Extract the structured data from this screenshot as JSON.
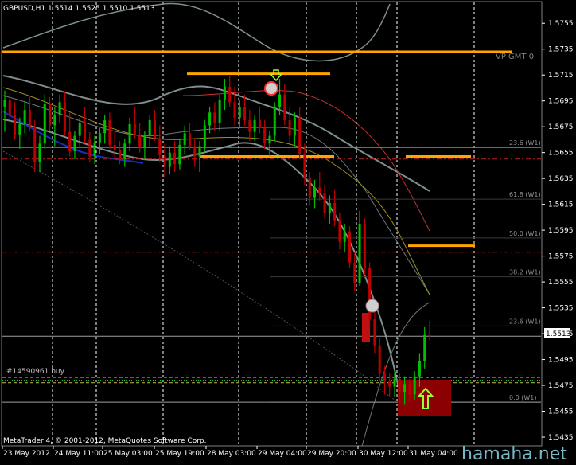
{
  "header": {
    "symbol_line": "GBPUSD,H1  1.5514 1.5525 1.5510 1.5513",
    "copyright": "MetaTrader 4, © 2001-2012, MetaQuotes Software Corp.",
    "watermark": "hamaha.net",
    "vp_label": "VP GMT 0",
    "order_label": "#14590961 buy"
  },
  "colors": {
    "background": "#000000",
    "bull_bar": "#00c000",
    "bear_bar": "#c00000",
    "grid": "#ffffff",
    "resistance": "#ffa500",
    "axis_text": "#ffffff",
    "price_tag_bg": "#ffffff",
    "envelope": "#7f8f8f",
    "zone_fill": "#8b0000",
    "arrow": "#9aff30"
  },
  "chart_data": {
    "type": "candlestick",
    "title": "GBPUSD,H1",
    "ylim": [
      1.5435,
      1.5765
    ],
    "y_ticks": [
      "1.5755",
      "1.5735",
      "1.5715",
      "1.5695",
      "1.5675",
      "1.5655",
      "1.5635",
      "1.5615",
      "1.5595",
      "1.5575",
      "1.5555",
      "1.5535",
      "1.5515",
      "1.5495",
      "1.5475",
      "1.5455",
      "1.5435"
    ],
    "current_price": "1.5513",
    "x_labels": [
      "23 May 2012",
      "24 May 11:00",
      "25 May 03:00",
      "25 May 19:00",
      "28 May 03:00",
      "29 May 04:00",
      "29 May 20:00",
      "30 May 12:00",
      "31 May 04:00"
    ],
    "fib_levels": [
      {
        "label": "23.6 (W1)",
        "value": 1.5659
      },
      {
        "label": "61.8 (W1)",
        "value": 1.5619
      },
      {
        "label": "50.0 (W1)",
        "value": 1.5589
      },
      {
        "label": "38.2 (W1)",
        "value": 1.5559
      },
      {
        "label": "23.6 (W1)",
        "value": 1.5521
      },
      {
        "label": "0.0 (W1)",
        "value": 1.5462
      }
    ],
    "resistance_levels": [
      1.5733,
      1.5716,
      1.5652,
      1.5583
    ],
    "dashed_levels": [
      1.565,
      1.5578,
      1.5481,
      1.5477
    ],
    "order_level": 1.5479,
    "ohlc": [
      {
        "o": 1.569,
        "h": 1.5703,
        "l": 1.5671,
        "c": 1.5696
      },
      {
        "o": 1.5696,
        "h": 1.5701,
        "l": 1.568,
        "c": 1.5684
      },
      {
        "o": 1.5684,
        "h": 1.5694,
        "l": 1.5665,
        "c": 1.5669
      },
      {
        "o": 1.5669,
        "h": 1.5682,
        "l": 1.5658,
        "c": 1.5677
      },
      {
        "o": 1.5677,
        "h": 1.5695,
        "l": 1.567,
        "c": 1.5688
      },
      {
        "o": 1.5688,
        "h": 1.5698,
        "l": 1.5672,
        "c": 1.5675
      },
      {
        "o": 1.5675,
        "h": 1.568,
        "l": 1.564,
        "c": 1.5648
      },
      {
        "o": 1.5648,
        "h": 1.5668,
        "l": 1.564,
        "c": 1.5662
      },
      {
        "o": 1.5662,
        "h": 1.57,
        "l": 1.5658,
        "c": 1.5693
      },
      {
        "o": 1.5693,
        "h": 1.5698,
        "l": 1.5672,
        "c": 1.5676
      },
      {
        "o": 1.5676,
        "h": 1.569,
        "l": 1.566,
        "c": 1.5684
      },
      {
        "o": 1.5684,
        "h": 1.57,
        "l": 1.5678,
        "c": 1.5694
      },
      {
        "o": 1.5694,
        "h": 1.5702,
        "l": 1.5668,
        "c": 1.5671
      },
      {
        "o": 1.5671,
        "h": 1.5686,
        "l": 1.5652,
        "c": 1.5656
      },
      {
        "o": 1.5656,
        "h": 1.5672,
        "l": 1.565,
        "c": 1.5668
      },
      {
        "o": 1.5668,
        "h": 1.5682,
        "l": 1.566,
        "c": 1.5678
      },
      {
        "o": 1.5678,
        "h": 1.569,
        "l": 1.5662,
        "c": 1.5665
      },
      {
        "o": 1.5665,
        "h": 1.5671,
        "l": 1.5648,
        "c": 1.5652
      },
      {
        "o": 1.5652,
        "h": 1.5668,
        "l": 1.5646,
        "c": 1.5663
      },
      {
        "o": 1.5663,
        "h": 1.5674,
        "l": 1.5654,
        "c": 1.567
      },
      {
        "o": 1.567,
        "h": 1.5684,
        "l": 1.5662,
        "c": 1.568
      },
      {
        "o": 1.568,
        "h": 1.5686,
        "l": 1.5658,
        "c": 1.5661
      },
      {
        "o": 1.5661,
        "h": 1.5672,
        "l": 1.565,
        "c": 1.5657
      },
      {
        "o": 1.5657,
        "h": 1.5664,
        "l": 1.5646,
        "c": 1.565
      },
      {
        "o": 1.565,
        "h": 1.5666,
        "l": 1.5644,
        "c": 1.5662
      },
      {
        "o": 1.5662,
        "h": 1.5682,
        "l": 1.5656,
        "c": 1.5677
      },
      {
        "o": 1.5677,
        "h": 1.569,
        "l": 1.5666,
        "c": 1.5669
      },
      {
        "o": 1.5669,
        "h": 1.5678,
        "l": 1.5655,
        "c": 1.5659
      },
      {
        "o": 1.5659,
        "h": 1.5672,
        "l": 1.565,
        "c": 1.5668
      },
      {
        "o": 1.5668,
        "h": 1.5684,
        "l": 1.566,
        "c": 1.568
      },
      {
        "o": 1.568,
        "h": 1.5688,
        "l": 1.5664,
        "c": 1.5666
      },
      {
        "o": 1.5666,
        "h": 1.5676,
        "l": 1.5648,
        "c": 1.5653
      },
      {
        "o": 1.5653,
        "h": 1.5662,
        "l": 1.5636,
        "c": 1.5644
      },
      {
        "o": 1.5644,
        "h": 1.566,
        "l": 1.5638,
        "c": 1.5655
      },
      {
        "o": 1.5655,
        "h": 1.5664,
        "l": 1.564,
        "c": 1.5646
      },
      {
        "o": 1.5646,
        "h": 1.5666,
        "l": 1.5642,
        "c": 1.5661
      },
      {
        "o": 1.5661,
        "h": 1.5676,
        "l": 1.5654,
        "c": 1.567
      },
      {
        "o": 1.567,
        "h": 1.5678,
        "l": 1.5657,
        "c": 1.566
      },
      {
        "o": 1.566,
        "h": 1.5666,
        "l": 1.5644,
        "c": 1.5652
      },
      {
        "o": 1.5652,
        "h": 1.5664,
        "l": 1.564,
        "c": 1.566
      },
      {
        "o": 1.566,
        "h": 1.568,
        "l": 1.5656,
        "c": 1.5676
      },
      {
        "o": 1.5676,
        "h": 1.569,
        "l": 1.567,
        "c": 1.5686
      },
      {
        "o": 1.5686,
        "h": 1.5694,
        "l": 1.5672,
        "c": 1.5678
      },
      {
        "o": 1.5678,
        "h": 1.57,
        "l": 1.5672,
        "c": 1.5696
      },
      {
        "o": 1.5696,
        "h": 1.5712,
        "l": 1.5688,
        "c": 1.5706
      },
      {
        "o": 1.5706,
        "h": 1.5714,
        "l": 1.569,
        "c": 1.5694
      },
      {
        "o": 1.5694,
        "h": 1.5706,
        "l": 1.5676,
        "c": 1.5682
      },
      {
        "o": 1.5682,
        "h": 1.5696,
        "l": 1.5674,
        "c": 1.569
      },
      {
        "o": 1.569,
        "h": 1.57,
        "l": 1.5676,
        "c": 1.568
      },
      {
        "o": 1.568,
        "h": 1.5688,
        "l": 1.5664,
        "c": 1.5671
      },
      {
        "o": 1.5671,
        "h": 1.5684,
        "l": 1.5664,
        "c": 1.568
      },
      {
        "o": 1.568,
        "h": 1.569,
        "l": 1.567,
        "c": 1.5674
      },
      {
        "o": 1.5674,
        "h": 1.568,
        "l": 1.5658,
        "c": 1.5662
      },
      {
        "o": 1.5662,
        "h": 1.5672,
        "l": 1.5652,
        "c": 1.5668
      },
      {
        "o": 1.5668,
        "h": 1.5694,
        "l": 1.5664,
        "c": 1.569
      },
      {
        "o": 1.569,
        "h": 1.5712,
        "l": 1.5684,
        "c": 1.57
      },
      {
        "o": 1.57,
        "h": 1.5708,
        "l": 1.5676,
        "c": 1.568
      },
      {
        "o": 1.568,
        "h": 1.569,
        "l": 1.5662,
        "c": 1.5668
      },
      {
        "o": 1.5668,
        "h": 1.5686,
        "l": 1.566,
        "c": 1.5682
      },
      {
        "o": 1.5682,
        "h": 1.569,
        "l": 1.565,
        "c": 1.5654
      },
      {
        "o": 1.5654,
        "h": 1.5662,
        "l": 1.563,
        "c": 1.5636
      },
      {
        "o": 1.5636,
        "h": 1.564,
        "l": 1.5614,
        "c": 1.562
      },
      {
        "o": 1.562,
        "h": 1.5634,
        "l": 1.5612,
        "c": 1.5628
      },
      {
        "o": 1.5628,
        "h": 1.564,
        "l": 1.5618,
        "c": 1.5624
      },
      {
        "o": 1.5624,
        "h": 1.563,
        "l": 1.5604,
        "c": 1.5608
      },
      {
        "o": 1.5608,
        "h": 1.5622,
        "l": 1.56,
        "c": 1.5616
      },
      {
        "o": 1.5616,
        "h": 1.5626,
        "l": 1.5598,
        "c": 1.5602
      },
      {
        "o": 1.5602,
        "h": 1.5608,
        "l": 1.558,
        "c": 1.5586
      },
      {
        "o": 1.5586,
        "h": 1.56,
        "l": 1.5578,
        "c": 1.5594
      },
      {
        "o": 1.5594,
        "h": 1.5598,
        "l": 1.5566,
        "c": 1.557
      },
      {
        "o": 1.557,
        "h": 1.5578,
        "l": 1.5548,
        "c": 1.5554
      },
      {
        "o": 1.5554,
        "h": 1.561,
        "l": 1.5552,
        "c": 1.56
      },
      {
        "o": 1.56,
        "h": 1.5604,
        "l": 1.556,
        "c": 1.5566
      },
      {
        "o": 1.5566,
        "h": 1.557,
        "l": 1.552,
        "c": 1.5526
      },
      {
        "o": 1.5526,
        "h": 1.5532,
        "l": 1.55,
        "c": 1.5506
      },
      {
        "o": 1.5506,
        "h": 1.5512,
        "l": 1.5478,
        "c": 1.5484
      },
      {
        "o": 1.5484,
        "h": 1.549,
        "l": 1.5468,
        "c": 1.5478
      },
      {
        "o": 1.5478,
        "h": 1.5484,
        "l": 1.5466,
        "c": 1.5474
      },
      {
        "o": 1.5474,
        "h": 1.5486,
        "l": 1.5466,
        "c": 1.548
      },
      {
        "o": 1.548,
        "h": 1.5484,
        "l": 1.5462,
        "c": 1.547
      },
      {
        "o": 1.547,
        "h": 1.5482,
        "l": 1.546,
        "c": 1.5476
      },
      {
        "o": 1.5476,
        "h": 1.548,
        "l": 1.5462,
        "c": 1.5468
      },
      {
        "o": 1.5468,
        "h": 1.5486,
        "l": 1.5464,
        "c": 1.5482
      },
      {
        "o": 1.5482,
        "h": 1.55,
        "l": 1.5474,
        "c": 1.5494
      },
      {
        "o": 1.5494,
        "h": 1.552,
        "l": 1.5488,
        "c": 1.5514
      },
      {
        "o": 1.5514,
        "h": 1.5525,
        "l": 1.551,
        "c": 1.5513
      }
    ]
  }
}
